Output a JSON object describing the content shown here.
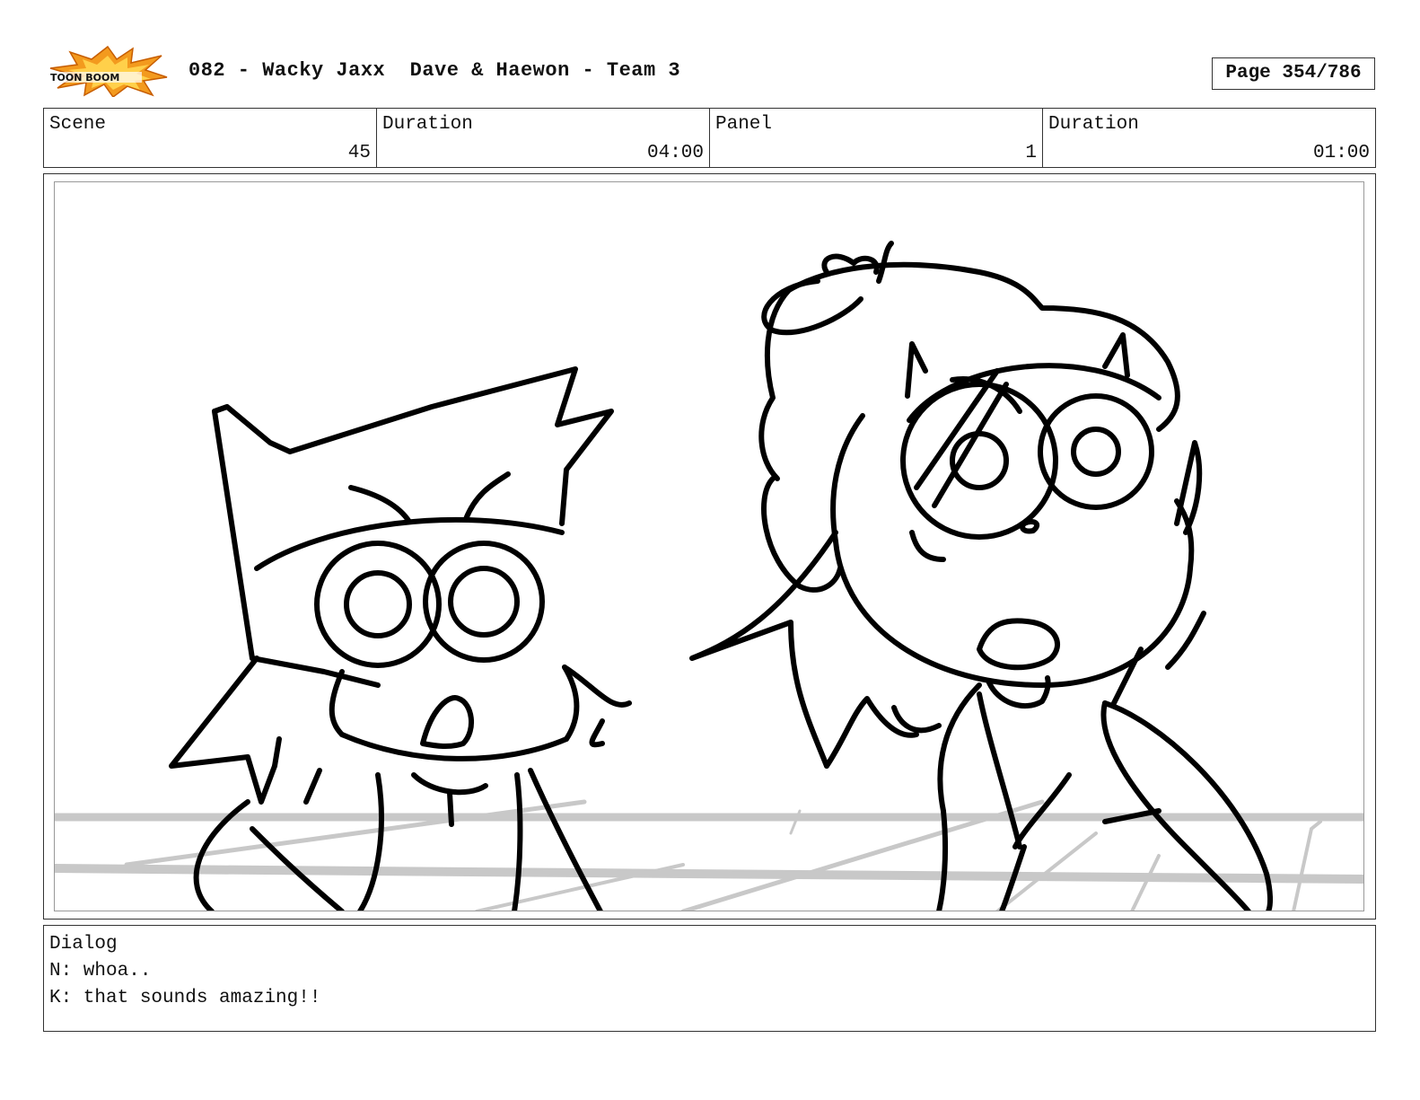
{
  "header": {
    "logo_text": "TOON BOOM",
    "title": "082 - Wacky Jaxx  Dave & Haewon - Team 3",
    "page": "Page 354/786"
  },
  "info": {
    "scene_label": "Scene",
    "scene_value": "45",
    "scene_duration_label": "Duration",
    "scene_duration_value": "04:00",
    "panel_label": "Panel",
    "panel_value": "1",
    "panel_duration_label": "Duration",
    "panel_duration_value": "01:00"
  },
  "dialog": {
    "label": "Dialog",
    "lines": [
      "N: whoa..",
      "K: that sounds amazing!!"
    ]
  },
  "colors": {
    "logo_orange": "#f39a1e",
    "sketch_ink": "#000000",
    "guide_gray": "#c8c8c8"
  }
}
